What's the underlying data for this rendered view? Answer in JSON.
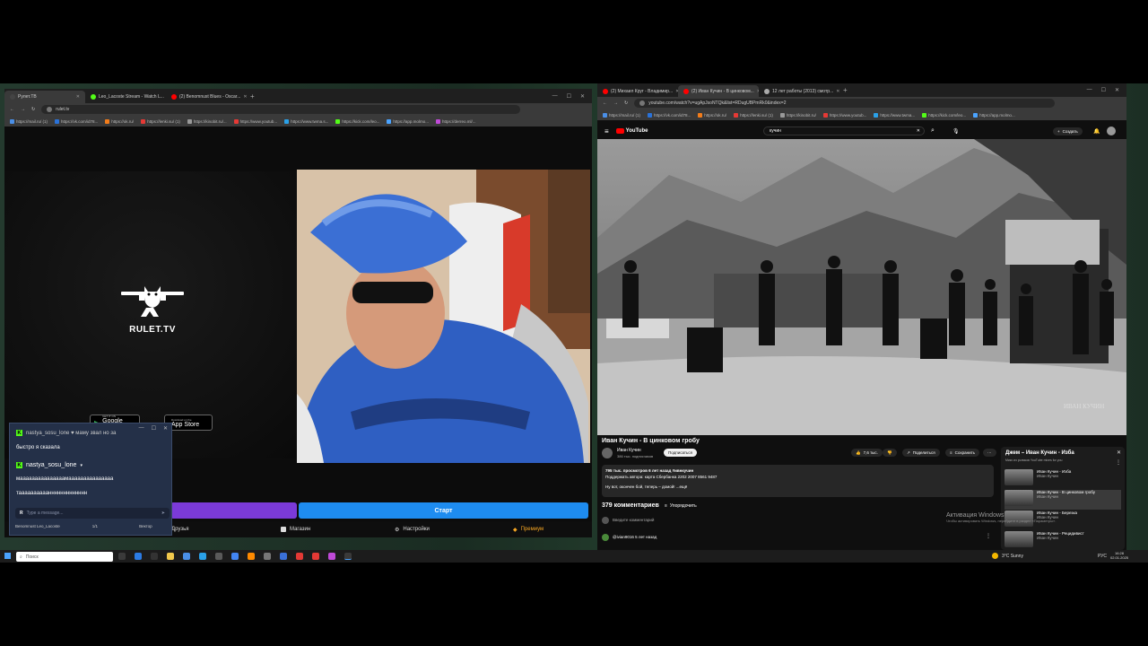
{
  "left_window": {
    "tabs": [
      {
        "label": "Рулет.ТВ",
        "favicon_color": "#444"
      },
      {
        "label": "Leo_Lacoste Stream - Watch L...",
        "favicon_color": "#53fc18"
      },
      {
        "label": "(2) Benomnust Blues - Oscar...",
        "favicon_color": "#ff0000"
      }
    ],
    "new_tab": "+",
    "url": "rulet.tv",
    "bookmarks": [
      "https://mail.ru/ (1)",
      "https://vk.com/id78...",
      "https://ok.ru/",
      "https://lenki.su/ (1)",
      "https://kinobit.ru/...",
      "https://www.youtub...",
      "https://www.twma.s...",
      "https://kick.com/leo...",
      "https://app.molmo...",
      "https://derreo.ml/..."
    ],
    "logo_text": "RULET.TV",
    "google_play": {
      "small": "GET IT ON",
      "label": "Google Play"
    },
    "app_store": {
      "small": "Download on the",
      "label": "App Store"
    },
    "start_button": "Старт",
    "nav": {
      "friends": "Друзья",
      "shop": "Магазин",
      "settings": "Настройки",
      "premium": "Премиум"
    }
  },
  "chat": {
    "top_partial": "nastya_sosu_lone ♥ маму звал но за",
    "msg1": "быстро я сказала",
    "nick2": "nastya_sosu_lone",
    "msg2a": "мааааааааааааааамааааааааааааааа",
    "msg2b": "тааааааааааннннннннннннн",
    "input_placeholder": "Type a message...",
    "footer_user": "Benomnust Leo_Lacoste",
    "footer_count": "1/1",
    "footer_right": "Вектор"
  },
  "right_window": {
    "tabs": [
      {
        "label": "(2) Михаил Круг - Владимир...",
        "favicon_color": "#ff0000"
      },
      {
        "label": "(2) Иван Кучин - В цинковом...",
        "favicon_color": "#ff0000"
      },
      {
        "label": "12 лет работы (2013) смотр...",
        "favicon_color": "#aaa"
      }
    ],
    "url": "youtube.com/watch?v=ugApJsoNTQk&list=RDugUBPmRk0&index=2",
    "bookmarks": [
      "https://mail.ru/ (1)",
      "https://vk.com/id78...",
      "https://ok.ru/",
      "https://lenki.su/ (1)",
      "https://kinobit.ru/",
      "https://www.youtub...",
      "https://www.twma...",
      "https://kick.com/leo...",
      "https://app.molmo..."
    ],
    "yt": {
      "logo": "YouTube",
      "search_value": "кучин",
      "create": "Создать",
      "video_watermark": "ИВАН КУЧИН",
      "title": "Иван Кучин - В цинковом гробу",
      "channel": "Иван Кучин",
      "subs": "386 тыс. подписчиков",
      "subscribe": "Подписаться",
      "likes": "7,6 тыс.",
      "share": "Поделиться",
      "save": "Сохранить",
      "desc_line1": "795 тыс. просмотров  6 лет назад  #ивнкучин",
      "desc_line2": "Поддержать автора: карта Сбербанка 2202 2007 8561 9487",
      "desc_line3": "Ну вот, окончен бой, теперь – домой! ...ещё",
      "comments_count": "379 комментариев",
      "sort": "Упорядочить",
      "add_comment": "Введите комментарий",
      "commenter": "@ivian9016  5 лет назад",
      "playlist_title": "Джем – Иван Кучин - Изба",
      "playlist_sub": "Микс из роликов YouTube mixes for you",
      "playlist": [
        {
          "title": "Иван Кучин - Изба",
          "channel": "Иван Кучин",
          "dur": "4:12"
        },
        {
          "title": "Иван Кучин - В цинковом гробу",
          "channel": "Иван Кучин",
          "dur": "3:54"
        },
        {
          "title": "Иван Кучин - Березка",
          "channel": "Иван Кучин",
          "dur": "3:31"
        },
        {
          "title": "Иван Кучин - Рецидивист",
          "channel": "Иван Кучин",
          "dur": "4:05"
        }
      ]
    }
  },
  "activation": {
    "title": "Активация Windows",
    "sub": "Чтобы активировать Windows, перейдите в раздел «Параметры»."
  },
  "taskbar": {
    "search_placeholder": "Поиск",
    "weather": "3°C  Sunny",
    "lang": "РУС",
    "time": "16:28",
    "date": "02.01.2025"
  }
}
